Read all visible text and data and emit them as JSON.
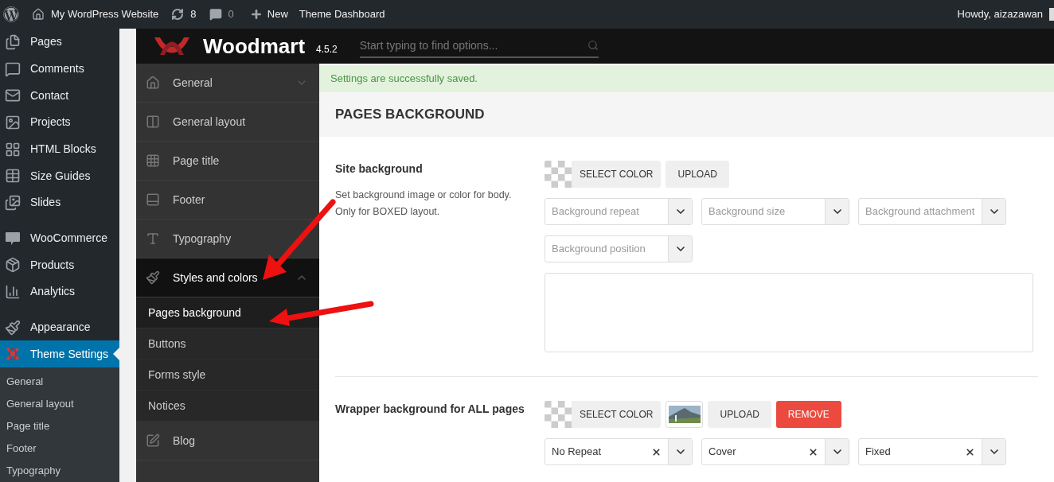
{
  "admin_bar": {
    "site_name": "My WordPress Website",
    "updates": "8",
    "comments": "0",
    "new": "New",
    "link": "Theme Dashboard",
    "greeting": "Howdy, aizazawan"
  },
  "wp_menu": [
    {
      "label": "Pages",
      "kind": "pages",
      "selected": false,
      "separator_before": false
    },
    {
      "label": "Comments",
      "kind": "comments",
      "selected": false,
      "separator_before": false
    },
    {
      "label": "Contact",
      "kind": "mail",
      "selected": false,
      "separator_before": false
    },
    {
      "label": "Projects",
      "kind": "gallery",
      "selected": false,
      "separator_before": false
    },
    {
      "label": "HTML Blocks",
      "kind": "blocks",
      "selected": false,
      "separator_before": false
    },
    {
      "label": "Size Guides",
      "kind": "table",
      "selected": false,
      "separator_before": false
    },
    {
      "label": "Slides",
      "kind": "slides",
      "selected": false,
      "separator_before": false
    },
    {
      "label": "WooCommerce",
      "kind": "woo",
      "selected": false,
      "separator_before": true
    },
    {
      "label": "Products",
      "kind": "box",
      "selected": false,
      "separator_before": false
    },
    {
      "label": "Analytics",
      "kind": "chart",
      "selected": false,
      "separator_before": false
    },
    {
      "label": "Appearance",
      "kind": "brush",
      "selected": false,
      "separator_before": true
    },
    {
      "label": "Theme Settings",
      "kind": "theme",
      "selected": true,
      "separator_before": false
    }
  ],
  "wp_submenu": [
    "General",
    "General layout",
    "Page title",
    "Footer",
    "Typography"
  ],
  "theme_header": {
    "brand": "Woodmart",
    "version": "4.5.2",
    "search_placeholder": "Start typing to find options..."
  },
  "theme_menu": [
    {
      "label": "General",
      "kind": "home",
      "expanded": false
    },
    {
      "label": "General layout",
      "kind": "layout"
    },
    {
      "label": "Page title",
      "kind": "grid"
    },
    {
      "label": "Footer",
      "kind": "footer"
    },
    {
      "label": "Typography",
      "kind": "type"
    },
    {
      "label": "Styles and colors",
      "kind": "brush",
      "expanded": true,
      "children": [
        {
          "label": "Pages background",
          "selected": true
        },
        {
          "label": "Buttons",
          "selected": false
        },
        {
          "label": "Forms style",
          "selected": false
        },
        {
          "label": "Notices",
          "selected": false
        }
      ]
    },
    {
      "label": "Blog",
      "kind": "edit"
    }
  ],
  "notice": "Settings are successfully saved.",
  "section_title": "PAGES BACKGROUND",
  "settings": [
    {
      "label": "Site background",
      "description": "Set background image or color for body. Only for BOXED layout.",
      "color_button": "SELECT COLOR",
      "upload_button": "UPLOAD",
      "has_image": false,
      "selects": [
        {
          "placeholder": "Background repeat"
        },
        {
          "placeholder": "Background size"
        },
        {
          "placeholder": "Background attachment"
        },
        {
          "placeholder": "Background position"
        }
      ],
      "preview_area": true
    },
    {
      "label": "Wrapper background for ALL pages",
      "color_button": "SELECT COLOR",
      "upload_button": "UPLOAD",
      "has_image": true,
      "remove_button": "REMOVE",
      "selects": [
        {
          "value": "No Repeat"
        },
        {
          "value": "Cover"
        },
        {
          "value": "Fixed"
        }
      ],
      "preview_area": false
    }
  ]
}
